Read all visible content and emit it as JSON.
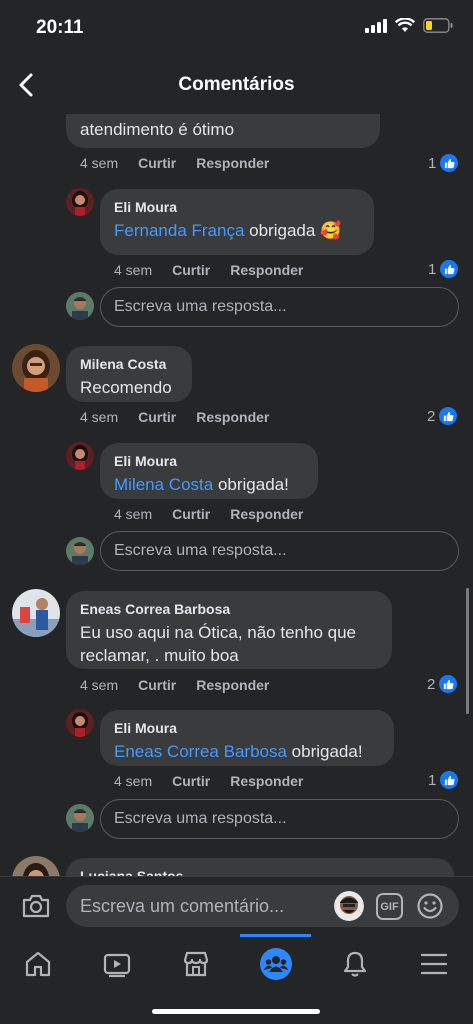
{
  "status": {
    "time": "20:11"
  },
  "header": {
    "title": "Comentários"
  },
  "thread": [
    {
      "text": "atendimento é ótimo",
      "time": "4 sem",
      "like": "Curtir",
      "reply": "Responder",
      "likes": "1"
    },
    {
      "author": "Eli Moura",
      "mention": "Fernanda França",
      "text": "obrigada",
      "emoji": "🥰",
      "time": "4 sem",
      "like": "Curtir",
      "reply": "Responder",
      "likes": "1"
    },
    {
      "reply_placeholder": "Escreva uma resposta..."
    },
    {
      "author": "Milena Costa",
      "text": "Recomendo",
      "time": "4 sem",
      "like": "Curtir",
      "reply": "Responder",
      "likes": "2"
    },
    {
      "author": "Eli Moura",
      "mention": "Milena Costa",
      "text": "obrigada!",
      "time": "4 sem",
      "like": "Curtir",
      "reply": "Responder"
    },
    {
      "reply_placeholder": "Escreva uma resposta..."
    },
    {
      "author": "Eneas Correa Barbosa",
      "text": "Eu uso aqui na Ótica, não tenho que reclamar, . muito boa",
      "time": "4 sem",
      "like": "Curtir",
      "reply": "Responder",
      "likes": "2"
    },
    {
      "author": "Eli Moura",
      "mention": "Eneas Correa Barbosa",
      "text": "obrigada!",
      "time": "4 sem",
      "like": "Curtir",
      "reply": "Responder",
      "likes": "1"
    },
    {
      "reply_placeholder": "Escreva uma resposta..."
    },
    {
      "author": "Luciana Santos"
    }
  ],
  "composer": {
    "placeholder": "Escreva um comentário...",
    "gif_label": "GIF"
  },
  "tabs": [
    "home-icon",
    "watch-icon",
    "marketplace-icon",
    "groups-icon",
    "notifications-icon",
    "menu-icon"
  ],
  "colors": {
    "background": "#242526",
    "bubble": "#3a3b3c",
    "mention": "#4599ff",
    "accent": "#2d88ff",
    "like_badge": "#1877f2"
  }
}
